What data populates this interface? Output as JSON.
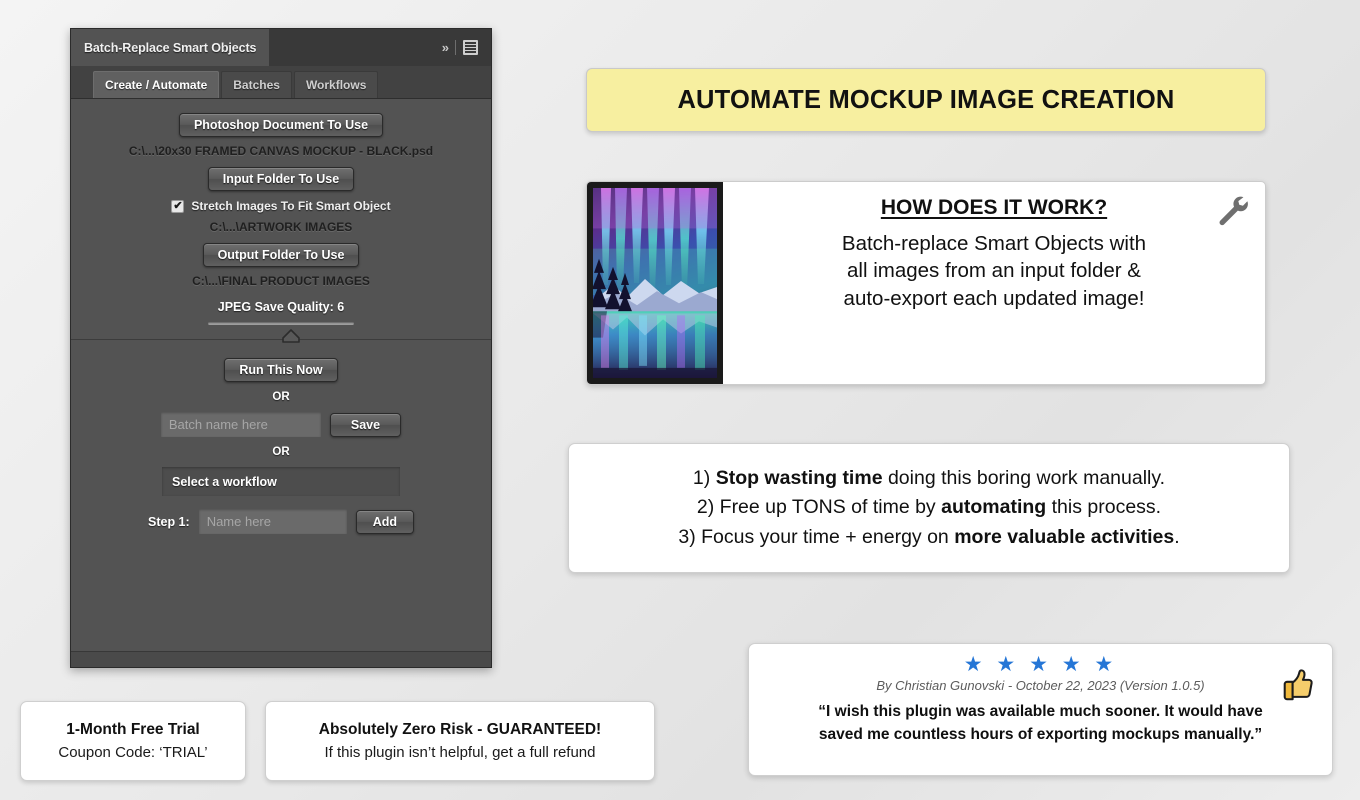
{
  "panel": {
    "title": "Batch-Replace Smart Objects",
    "title_icons": {
      "expand": "chevron-double-right-icon",
      "menu": "hamburger-menu-icon"
    },
    "tabs": [
      {
        "label": "Create / Automate",
        "active": true
      },
      {
        "label": "Batches",
        "active": false
      },
      {
        "label": "Workflows",
        "active": false
      }
    ],
    "create_section": {
      "psd_button": "Photoshop Document To Use",
      "psd_path": "C:\\...\\20x30 FRAMED CANVAS MOCKUP - BLACK.psd",
      "input_button": "Input Folder To Use",
      "stretch_checkbox_label": "Stretch Images To Fit Smart Object",
      "stretch_checkbox_checked": true,
      "stretch_checkbox_glyph": "✔",
      "input_path": "C:\\...\\ARTWORK IMAGES",
      "output_button": "Output Folder To Use",
      "output_path": "C:\\...\\FINAL PRODUCT IMAGES",
      "quality_label": "JPEG Save Quality: 6",
      "quality_value": 6
    },
    "run_section": {
      "run_button": "Run This Now",
      "or_1": "OR",
      "batch_name_placeholder": "Batch name here",
      "batch_name_value": "",
      "save_button": "Save",
      "or_2": "OR",
      "workflow_select_value": "Select a workflow",
      "step_label": "Step 1:",
      "step_name_placeholder": "Name here",
      "step_name_value": "",
      "add_button": "Add"
    }
  },
  "banner": {
    "text": "AUTOMATE MOCKUP IMAGE CREATION",
    "bg_color": "#f7efa0"
  },
  "how_card": {
    "thumbnail_alt": "aurora-borealis-framed-canvas-mockup",
    "title": "HOW DOES IT WORK?",
    "body_lines": [
      "Batch-replace Smart Objects with",
      "all images from an input folder &",
      "auto-export each updated image!"
    ],
    "icon": "wrench-icon"
  },
  "points_card": {
    "lines": [
      {
        "number": "1)",
        "pre": "",
        "bold": "Stop wasting time",
        "post": " doing this boring work manually."
      },
      {
        "number": "2)",
        "pre": " Free up TONS of time by ",
        "bold": "automating",
        "post": " this process."
      },
      {
        "number": "3)",
        "pre": " Focus your time + energy on ",
        "bold": "more valuable activities",
        "post": "."
      }
    ]
  },
  "review_card": {
    "stars": "★ ★ ★ ★ ★",
    "star_count": 5,
    "star_color": "#2576d6",
    "byline": "By Christian Gunovski - October 22, 2023 (Version 1.0.5)",
    "quote_line_1": "“I wish this plugin was available much sooner. It would have",
    "quote_line_2": "saved me countless hours of exporting mockups manually.”",
    "icon": "thumbs-up-icon"
  },
  "trial_box": {
    "title": "1-Month Free Trial",
    "subtitle": "Coupon Code: ‘TRIAL’"
  },
  "risk_box": {
    "title": "Absolutely Zero Risk - GUARANTEED!",
    "subtitle": "If this plugin isn’t helpful, get a full refund"
  }
}
